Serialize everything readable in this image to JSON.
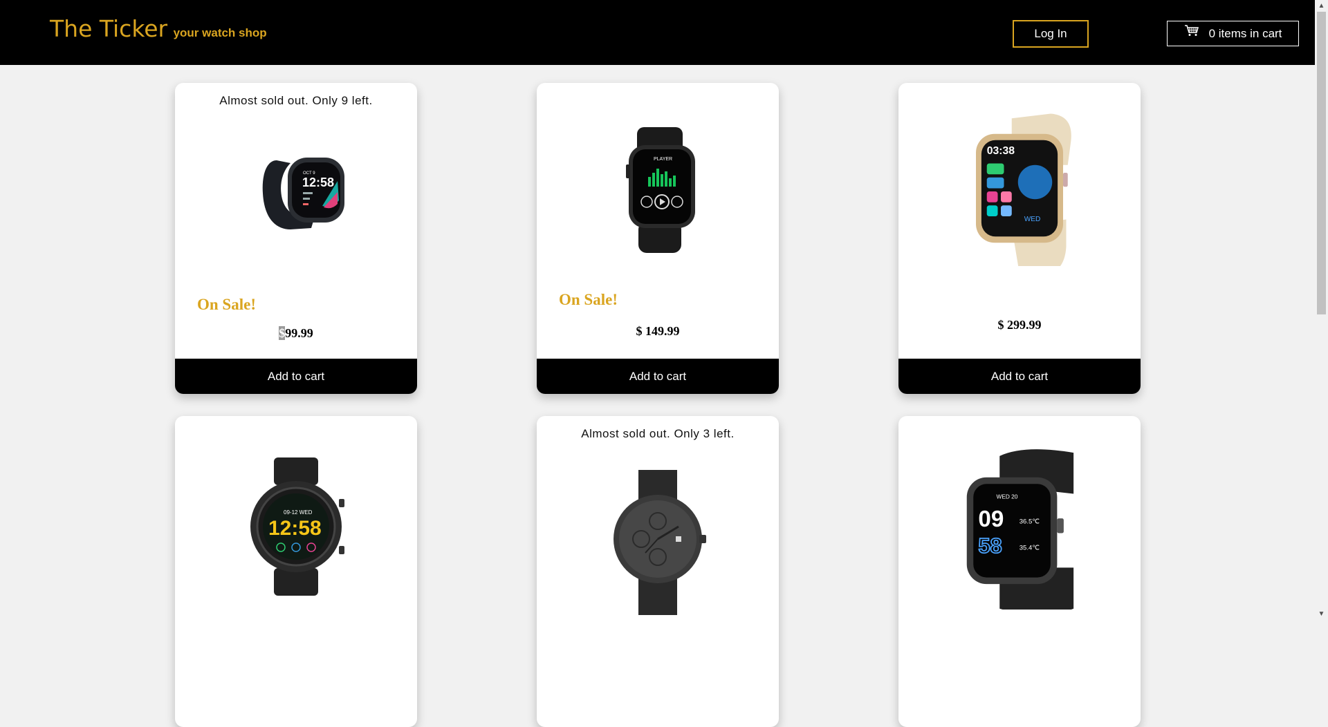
{
  "header": {
    "brand_name": "The Ticker",
    "brand_tagline": "your watch shop",
    "login_label": "Log In",
    "cart_label": "0 items in cart",
    "accent_color": "#daa520"
  },
  "products": [
    {
      "stock_note": "Almost sold out. Only 9 left.",
      "sale_label": "On Sale!",
      "currency": "$",
      "amount": "99.99",
      "button": "Add to cart"
    },
    {
      "stock_note": "",
      "sale_label": "On Sale!",
      "price": "$ 149.99",
      "button": "Add to cart"
    },
    {
      "stock_note": "",
      "sale_label": "",
      "price": "$ 299.99",
      "button": "Add to cart"
    },
    {
      "stock_note": "",
      "sale_label": "",
      "price": "",
      "button": ""
    },
    {
      "stock_note": "Almost sold out. Only 3 left.",
      "sale_label": "",
      "price": "",
      "button": ""
    },
    {
      "stock_note": "",
      "sale_label": "",
      "price": "",
      "button": ""
    }
  ],
  "watch_faces": {
    "w1_date": "OCT 9",
    "w1_time": "12:58",
    "w2_label": "PLAYER",
    "w3_time": "03:38",
    "w3_day": "WED",
    "w4_date": "09-12 WED",
    "w4_time": "12:58",
    "w6_date": "WED 20",
    "w6_hour": "09",
    "w6_min": "58",
    "w6_t1": "36.5℃",
    "w6_t2": "35.4℃"
  },
  "icons": {
    "cart": "shopping-cart-icon",
    "scroll_up": "chevron-up-icon",
    "scroll_down": "chevron-down-icon"
  }
}
